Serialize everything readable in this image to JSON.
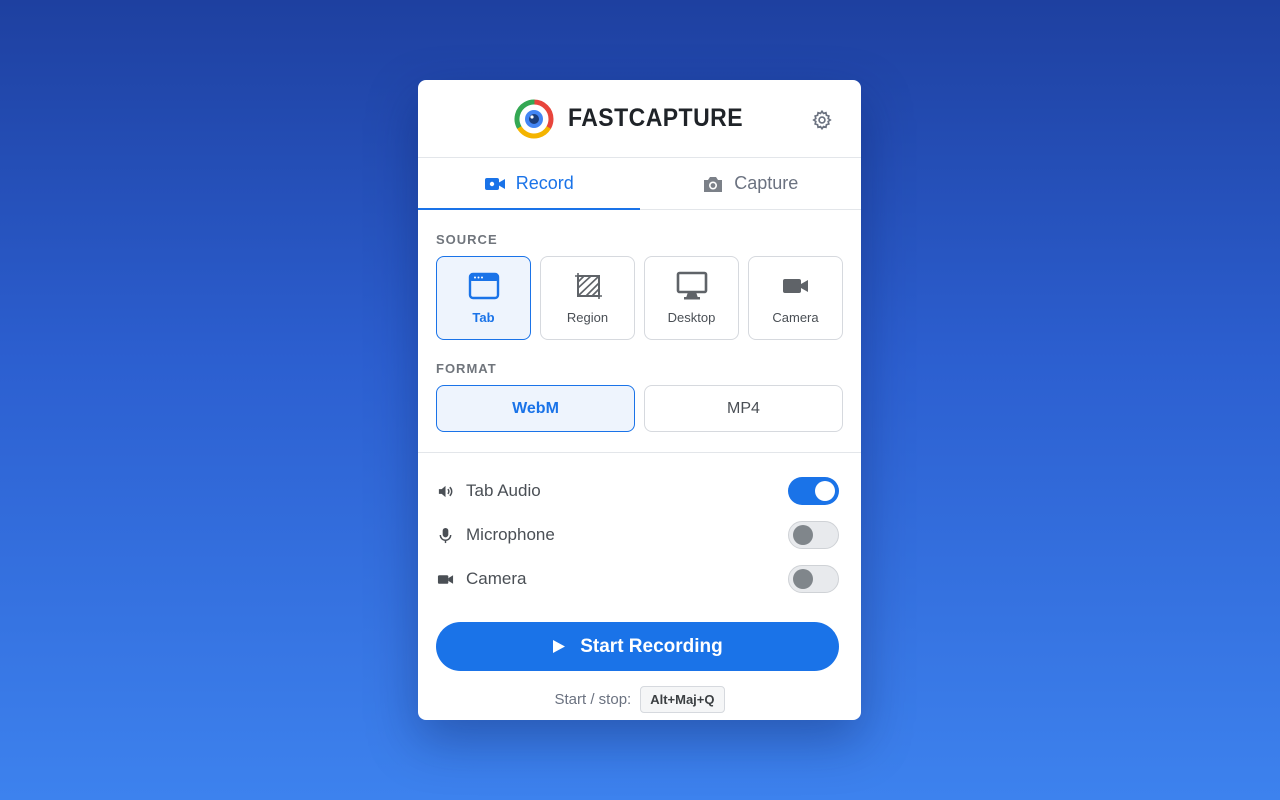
{
  "app": {
    "name": "FASTCAPTURE"
  },
  "tabs": [
    {
      "label": "Record",
      "icon": "video-camera-icon",
      "active": true
    },
    {
      "label": "Capture",
      "icon": "photo-camera-icon",
      "active": false
    }
  ],
  "source": {
    "label": "SOURCE",
    "items": [
      {
        "label": "Tab",
        "icon": "browser-tab-icon",
        "selected": true
      },
      {
        "label": "Region",
        "icon": "region-select-icon",
        "selected": false
      },
      {
        "label": "Desktop",
        "icon": "monitor-icon",
        "selected": false
      },
      {
        "label": "Camera",
        "icon": "video-camera-icon",
        "selected": false
      }
    ]
  },
  "format": {
    "label": "FORMAT",
    "items": [
      {
        "label": "WebM",
        "selected": true
      },
      {
        "label": "MP4",
        "selected": false
      }
    ]
  },
  "options": [
    {
      "label": "Tab Audio",
      "icon": "speaker-icon",
      "enabled": true
    },
    {
      "label": "Microphone",
      "icon": "microphone-icon",
      "enabled": false
    },
    {
      "label": "Camera",
      "icon": "video-camera-icon",
      "enabled": false
    }
  ],
  "start_button": {
    "label": "Start Recording",
    "icon": "play-icon"
  },
  "shortcut": {
    "label": "Start / stop:",
    "keys": "Alt+Maj+Q"
  },
  "colors": {
    "accent": "#1a73e8",
    "selected_bg": "#eef4fd",
    "toggle_off": "#e8eaed"
  }
}
